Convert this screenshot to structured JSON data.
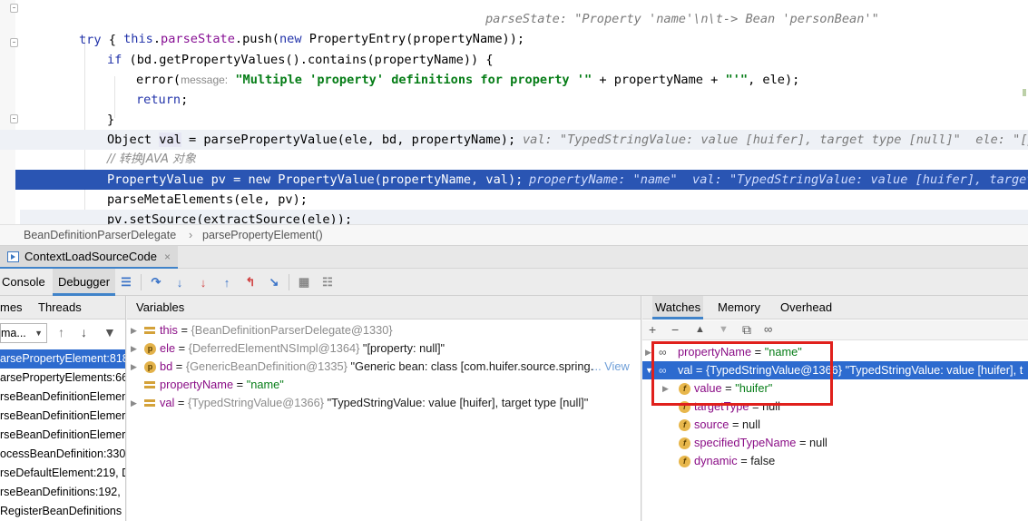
{
  "editor": {
    "lines": {
      "l1": {
        "a": "this",
        "b": ".",
        "c": "parseState",
        "d": ".push(",
        "e": "new",
        "f": " PropertyEntry(propertyName));",
        "hint": "parseState: \"Property 'name'\\n\\t-> Bean 'personBean'\""
      },
      "l2": {
        "kw": "try",
        "rest": " {"
      },
      "l3": {
        "kw": "if",
        "rest": " (bd.getPropertyValues().contains(propertyName)) {"
      },
      "l4": {
        "fn": "error(",
        "param": "message:",
        "str": " \"Multiple 'property' definitions for property '\"",
        "rest": " + propertyName + ",
        "str2": "\"'\"",
        "rest2": ", ele);"
      },
      "l5": {
        "kw": "return",
        "rest": ";"
      },
      "l6": {
        "rest": "}"
      },
      "l7": {
        "pre": "Object ",
        "var": "val",
        "post": " = parsePropertyValue(ele, bd, propertyName);",
        "hint": "val: \"TypedStringValue: value [huifer], target type [null]\"  ele: \"[pr"
      },
      "l8": {
        "comment": "// 转换JAVA 对象"
      },
      "l9": {
        "code": "PropertyValue pv = new PropertyValue(propertyName, val);",
        "hint": "propertyName: \"name\"  val: \"TypedStringValue: value [huifer], target"
      },
      "l10": {
        "code": "parseMetaElements(ele, pv);"
      },
      "l11": {
        "code": "pv.setSource(extractSource(ele));"
      }
    }
  },
  "breadcrumb": {
    "class_name": "BeanDefinitionParserDelegate",
    "separator": "›",
    "method_name": "parsePropertyElement()"
  },
  "debug": {
    "run_config": "ContextLoadSourceCode",
    "close": "×",
    "tabs": {
      "console": "Console",
      "debugger": "Debugger"
    },
    "frames_header": {
      "frames": "mes",
      "threads": "Threads"
    },
    "thread_select": "ma...",
    "frames": [
      "arsePropertyElement:818",
      "arsePropertyElements:662",
      "rseBeanDefinitionElement",
      "rseBeanDefinitionElemer",
      "rseBeanDefinitionElemer",
      "ocessBeanDefinition:330",
      "rseDefaultElement:219, D",
      "rseBeanDefinitions:192,",
      "RegisterBeanDefinitions"
    ],
    "variables_header": "Variables",
    "variables": [
      {
        "name": "this",
        "eq": " = ",
        "ref": "{BeanDefinitionParserDelegate@1330}",
        "value": ""
      },
      {
        "name": "ele",
        "eq": " = ",
        "ref": "{DeferredElementNSImpl@1364}",
        "value": " \"[property: null]\""
      },
      {
        "name": "bd",
        "eq": " = ",
        "ref": "{GenericBeanDefinition@1335}",
        "value": " \"Generic bean: class [com.huifer.source.spring.",
        "link": "... View"
      },
      {
        "name": "propertyName",
        "eq": " = ",
        "ref": "",
        "value": "\"name\""
      },
      {
        "name": "val",
        "eq": " = ",
        "ref": "{TypedStringValue@1366}",
        "value": " \"TypedStringValue: value [huifer], target type [null]\""
      }
    ],
    "watches_tabs": {
      "watches": "Watches",
      "memory": "Memory",
      "overhead": "Overhead"
    },
    "watches": [
      {
        "name": "propertyName",
        "eq": " = ",
        "value": "\"name\""
      },
      {
        "name": "val",
        "eq": " = ",
        "ref": "{TypedStringValue@1366}",
        "value": " \"TypedStringValue: value [huifer], t"
      },
      {
        "name": "value",
        "eq": " = ",
        "value": "\"huifer\""
      },
      {
        "name": "targetType",
        "eq": " = ",
        "value": "null"
      },
      {
        "name": "source",
        "eq": " = ",
        "value": "null"
      },
      {
        "name": "specifiedTypeName",
        "eq": " = ",
        "value": "null"
      },
      {
        "name": "dynamic",
        "eq": " = ",
        "value": "false"
      }
    ]
  },
  "colors": {
    "execution_line": "#2a55b3",
    "selection": "#2d6bcf",
    "annotation_box": "#e0201c"
  }
}
